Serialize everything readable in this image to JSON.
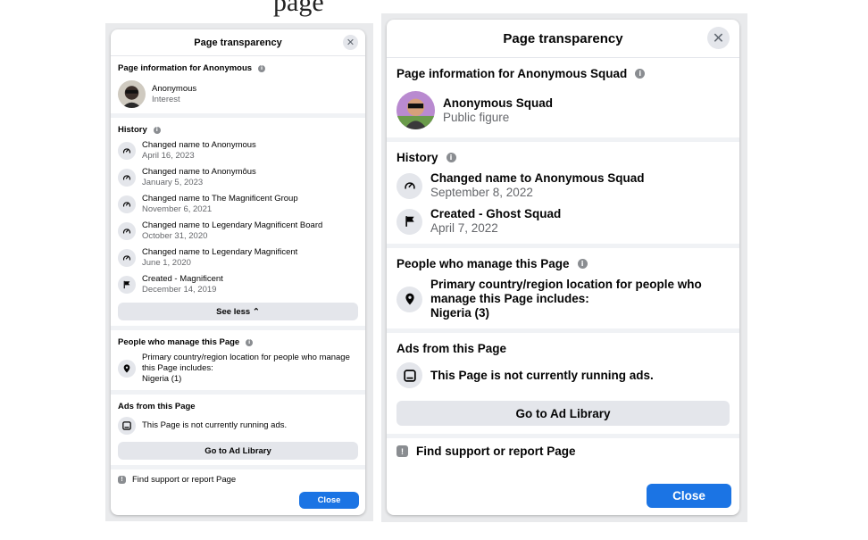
{
  "page_heading_fragment": "page",
  "left": {
    "title": "Page transparency",
    "page_info_title": "Page information for Anonymous",
    "page_name": "Anonymous",
    "page_category": "Interest",
    "history_title": "History",
    "history": [
      {
        "primary": "Changed name to Anonymous",
        "secondary": "April 16, 2023",
        "icon": "rename-icon"
      },
      {
        "primary": "Changed name to Anonymôus",
        "secondary": "January 5, 2023",
        "icon": "rename-icon"
      },
      {
        "primary": "Changed name to The Magnificent Group",
        "secondary": "November 6, 2021",
        "icon": "rename-icon"
      },
      {
        "primary": "Changed name to Legendary Magnificent Board",
        "secondary": "October 31, 2020",
        "icon": "rename-icon"
      },
      {
        "primary": "Changed name to Legendary Magnificent",
        "secondary": "June 1, 2020",
        "icon": "rename-icon"
      },
      {
        "primary": "Created - Magnificent",
        "secondary": "December 14, 2019",
        "icon": "flag-icon"
      }
    ],
    "see_less": "See less ⌃",
    "manage_title": "People who manage this Page",
    "manage_text": "Primary country/region location for people who manage this Page includes:",
    "manage_country": "Nigeria (1)",
    "ads_title": "Ads from this Page",
    "ads_text": "This Page is not currently running ads.",
    "ad_library_button": "Go to Ad Library",
    "support_text": "Find support or report Page",
    "close_button": "Close"
  },
  "right": {
    "title": "Page transparency",
    "page_info_title": "Page information for Anonymous Squad",
    "page_name": "Anonymous Squad",
    "page_category": "Public figure",
    "history_title": "History",
    "history": [
      {
        "primary": "Changed name to Anonymous Squad",
        "secondary": "September 8, 2022",
        "icon": "rename-icon"
      },
      {
        "primary": "Created - Ghost Squad",
        "secondary": "April 7, 2022",
        "icon": "flag-icon"
      }
    ],
    "manage_title": "People who manage this Page",
    "manage_text": "Primary country/region location for people who manage this Page includes:",
    "manage_country": "Nigeria (3)",
    "ads_title": "Ads from this Page",
    "ads_text": "This Page is not currently running ads.",
    "ad_library_button": "Go to Ad Library",
    "support_text": "Find support or report Page",
    "close_button": "Close"
  },
  "colors": {
    "accent": "#1b74e4",
    "secondary_text": "#65676b",
    "button_gray": "#e4e6eb"
  }
}
